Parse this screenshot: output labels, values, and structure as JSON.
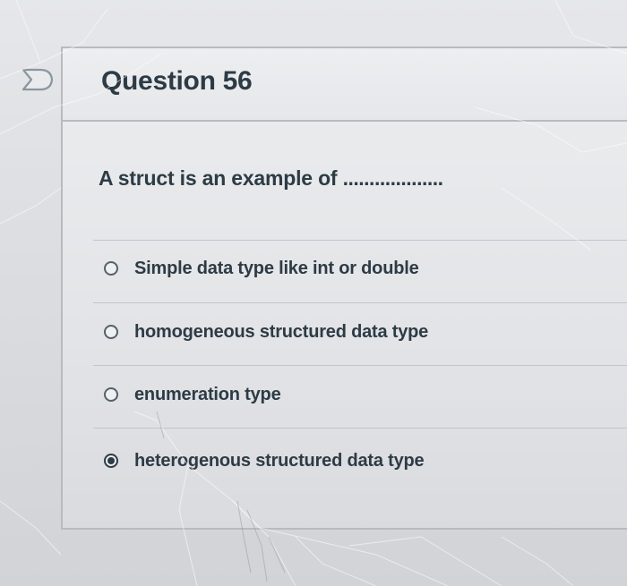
{
  "question": {
    "title": "Question 56",
    "flag_icon": "flag-outline-icon",
    "prompt_text": "A struct is an example of",
    "prompt_blank": "..................."
  },
  "answers": {
    "selected_index": 3,
    "options": [
      {
        "label": "Simple data type like int or double",
        "selected": false
      },
      {
        "label": "homogeneous structured data type",
        "selected": false
      },
      {
        "label": "enumeration type",
        "selected": false
      },
      {
        "label": "heterogenous structured data type",
        "selected": true
      }
    ]
  },
  "colors": {
    "text": "#2d3b45",
    "card_background": "#e6e7ea",
    "border": "#b9babe",
    "radio_border": "#55606a"
  }
}
